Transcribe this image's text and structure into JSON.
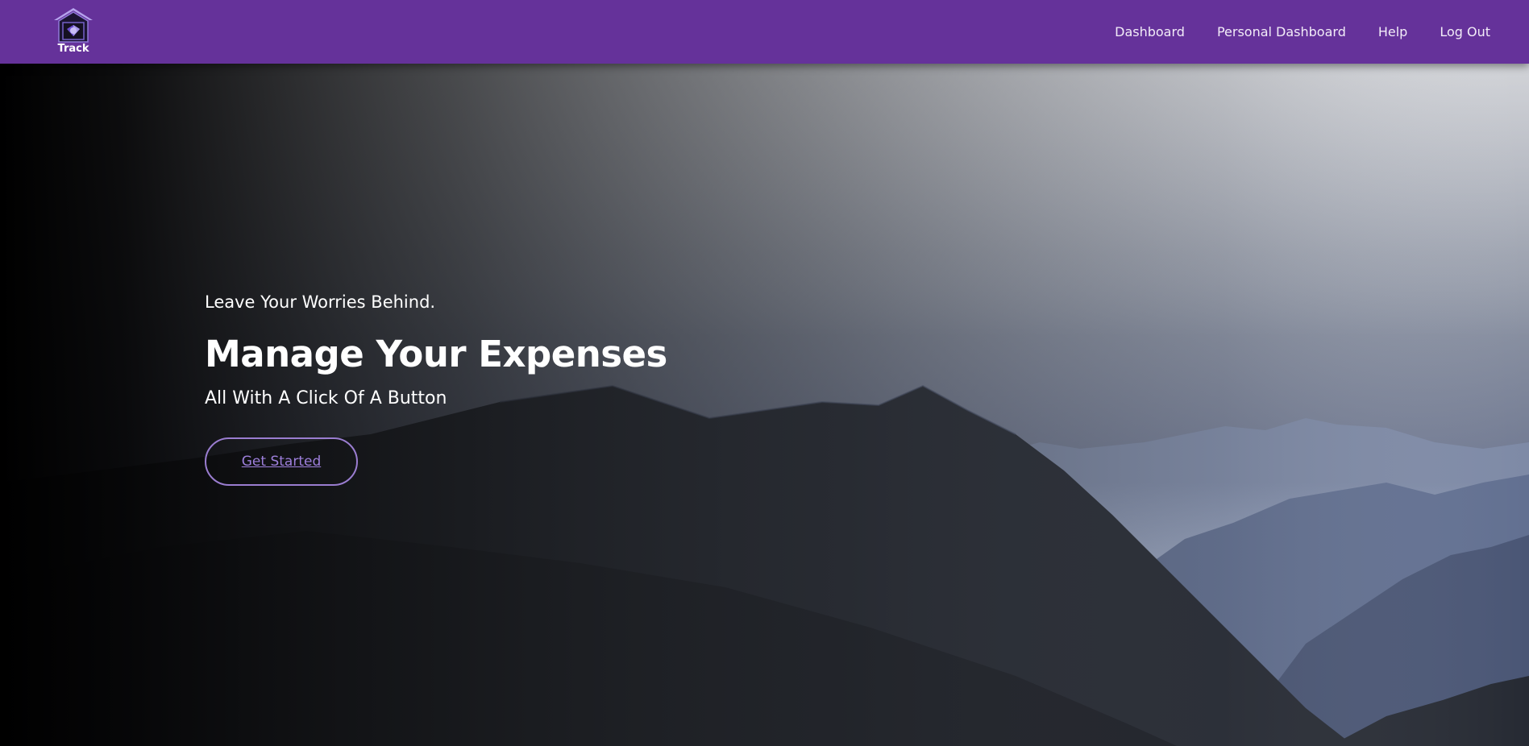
{
  "brand": {
    "logo_text": "Track",
    "color": "#65329a"
  },
  "nav": {
    "links": [
      {
        "label": "Dashboard"
      },
      {
        "label": "Personal Dashboard"
      },
      {
        "label": "Help"
      },
      {
        "label": "Log Out"
      }
    ]
  },
  "hero": {
    "tagline": "Leave Your Worries Behind.",
    "headline": "Manage Your Expenses",
    "subline": "All With A Click Of A Button",
    "cta_label": "Get Started"
  },
  "colors": {
    "accent": "#9a7dd0",
    "header": "#65329a"
  }
}
